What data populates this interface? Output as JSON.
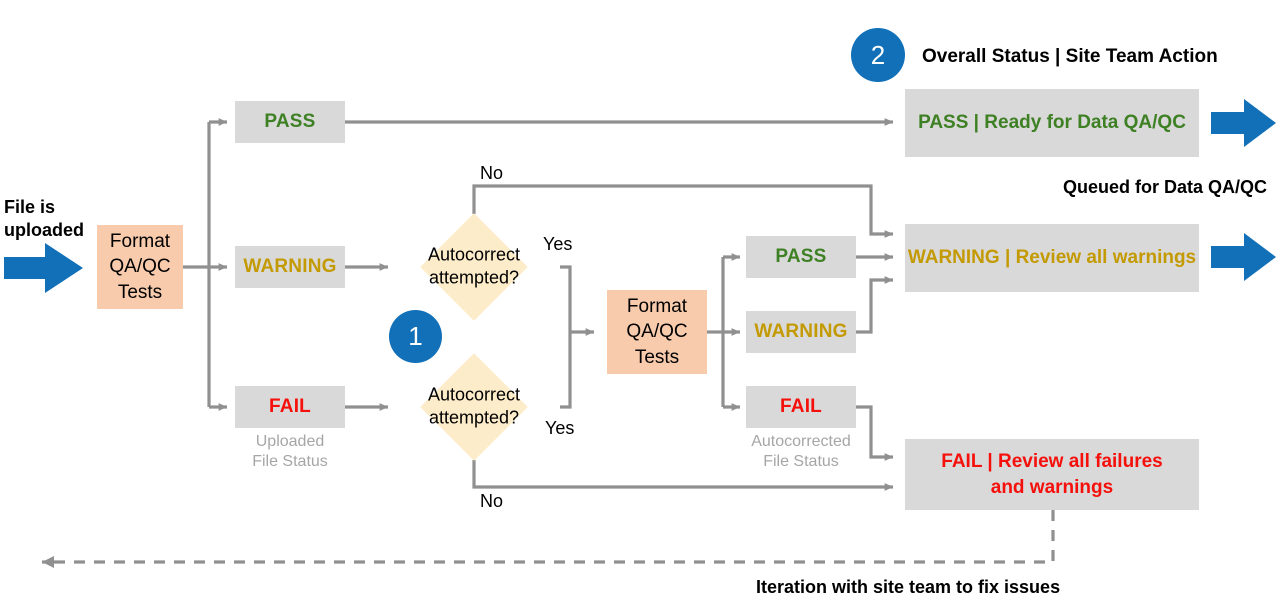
{
  "diagram": {
    "title_legend": "Overall Status | Site Team Action",
    "badge_two": "2",
    "badge_one": "1",
    "entry_label": "File is\nuploaded",
    "format_tests_1": "Format\nQA/QC\nTests",
    "format_tests_2": "Format\nQA/QC\nTests",
    "uploaded_status_caption": "Uploaded\nFile Status",
    "autocorrected_status_caption": "Autocorrected\nFile Status",
    "queued_note": "Queued for Data QA/QC",
    "iteration_note": "Iteration with site team to fix issues",
    "uploaded_statuses": [
      {
        "label": "PASS",
        "kind": "pass"
      },
      {
        "label": "WARNING",
        "kind": "warn"
      },
      {
        "label": "FAIL",
        "kind": "fail"
      }
    ],
    "autocorrected_statuses": [
      {
        "label": "PASS",
        "kind": "pass"
      },
      {
        "label": "WARNING",
        "kind": "warn"
      },
      {
        "label": "FAIL",
        "kind": "fail"
      }
    ],
    "decisions": [
      {
        "text": "Autocorrect\nattempted?",
        "yes": "Yes",
        "no": "No"
      },
      {
        "text": "Autocorrect\nattempted?",
        "yes": "Yes",
        "no": "No"
      }
    ],
    "outcomes": [
      {
        "status": "PASS",
        "sep": " | ",
        "action": "Ready for Data QA/QC",
        "kind": "pass"
      },
      {
        "status": "WARNING",
        "sep": " | ",
        "action": "Review all warnings",
        "kind": "warn"
      },
      {
        "status": "FAIL",
        "sep": " | ",
        "action": "Review all failures\nand warnings",
        "kind": "fail"
      }
    ],
    "colors": {
      "accent_blue": "#1270B8",
      "process_fill": "#F8CBAD",
      "chip_fill": "#D9D9D9",
      "diamond_fill": "#FCECC9",
      "connector": "#909090",
      "pass_green": "#3E8024",
      "warning_gold": "#C49A03",
      "fail_red": "#F5100B",
      "caption_grey": "#A6A6A6"
    }
  }
}
